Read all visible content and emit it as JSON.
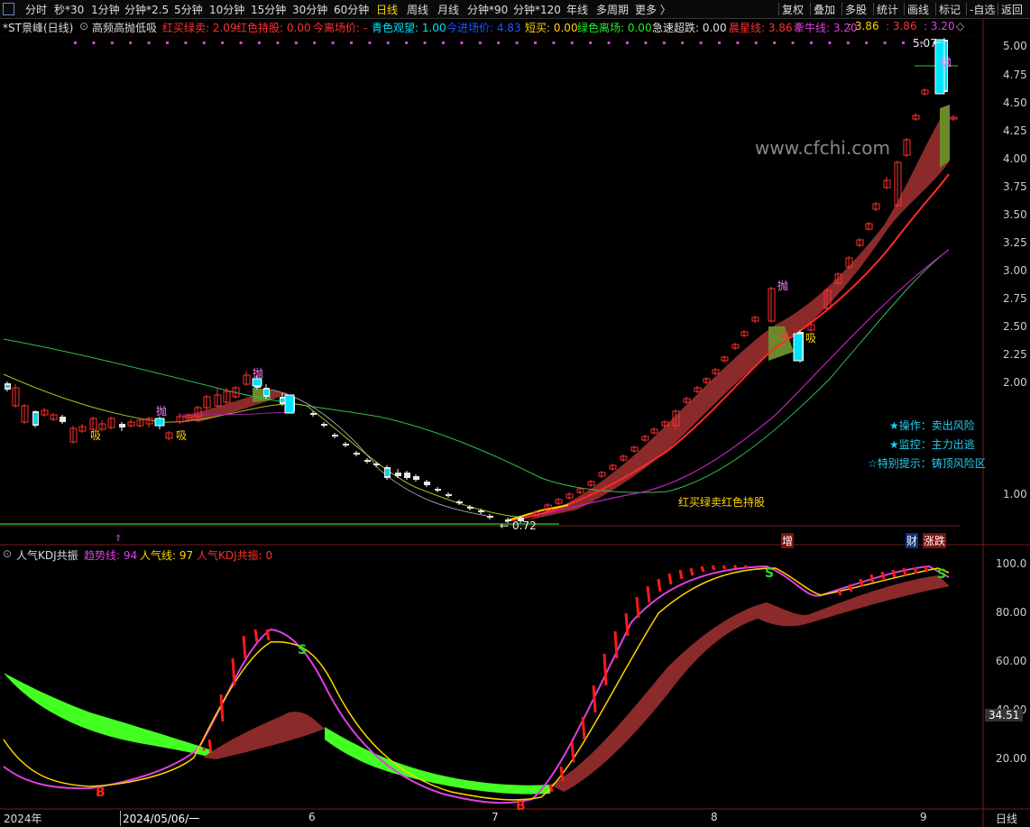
{
  "toolbar": {
    "left": [
      "分时",
      "秒*30",
      "1分钟",
      "分钟*2.5",
      "5分钟",
      "10分钟",
      "15分钟",
      "30分钟",
      "60分钟",
      "日线",
      "周线",
      "月线",
      "分钟*90",
      "分钟*120",
      "年线",
      "多周期",
      "更多 〉"
    ],
    "selected": "日线",
    "right": [
      "复权",
      "叠加",
      "多股",
      "统计",
      "画线",
      "标记",
      "-自选",
      "返回"
    ]
  },
  "main_info": {
    "title": "*ST景峰(日线)",
    "indicator": "高频高抛低吸",
    "items": [
      {
        "text": "红买绿卖: 2.09",
        "color": "#ff3030"
      },
      {
        "text": "红色持股: 0.00",
        "color": "#ff3030"
      },
      {
        "text": "今离场价: -",
        "color": "#ff3030"
      },
      {
        "text": "青色观望: 1.00",
        "color": "#00e5ff"
      },
      {
        "text": "今进场价: 4.83",
        "color": "#2255ff"
      },
      {
        "text": "短买: 0.00",
        "color": "#ffd400"
      },
      {
        "text": "绿色离场: 0.00",
        "color": "#22ee22"
      },
      {
        "text": "急速超跌: 0.00",
        "color": "#e0e0e0"
      },
      {
        "text": "晨星线: 3.86",
        "color": "#ff3030"
      },
      {
        "text": "牽牛线: 3.20",
        "color": "#e040e0"
      },
      {
        "text": ": 3.86",
        "color": "#ffd400"
      },
      {
        "text": ": 3.86",
        "color": "#ff3030"
      },
      {
        "text": ": 3.20",
        "color": "#e040e0"
      }
    ]
  },
  "price_axis": [
    "5.00",
    "4.75",
    "4.50",
    "4.25",
    "4.00",
    "3.75",
    "3.50",
    "3.25",
    "3.00",
    "2.75",
    "2.50",
    "2.25",
    "2.00",
    "1.00"
  ],
  "price_axis_full": [
    5.0,
    4.75,
    4.5,
    4.25,
    4.0,
    3.75,
    3.5,
    3.25,
    3.0,
    2.75,
    2.5,
    2.25,
    2.0,
    1.0
  ],
  "watermark": "www.cfchi.com",
  "annotations": {
    "high_label": "5.07",
    "low_label": "0.72",
    "pao": "抛",
    "xi": "吸",
    "hongmai": "红买绿卖红色持股",
    "op1": "★操作：卖出风险",
    "op2": "★监控：主力出逃",
    "op3": "☆特别提示：铸顶风险区",
    "zeng": "增",
    "cai": "财",
    "zhangdie": "涨跌"
  },
  "kdj_info": {
    "name": "人气KDJ共振",
    "items": [
      {
        "text": "趋势线: 94",
        "color": "#e040e0"
      },
      {
        "text": "人气线: 97",
        "color": "#ffd400"
      },
      {
        "text": "人气KDJ共振: 0",
        "color": "#ff3030"
      }
    ]
  },
  "kdj_axis": [
    "100.0",
    "80.00",
    "60.00",
    "40.00",
    "20.00"
  ],
  "kdj_current": "34.51",
  "kdj_marks": {
    "b": "B",
    "s": "S"
  },
  "x_axis": {
    "year": "2024年",
    "date": "2024/05/06/一",
    "months": [
      "6",
      "7",
      "8",
      "9"
    ],
    "period": "日线"
  },
  "chart_data": {
    "type": "candlestick",
    "y_range": [
      0.72,
      5.07
    ],
    "kdj": {
      "trend": 94,
      "popularity": 97,
      "resonance": 0,
      "ylim": [
        0,
        100
      ]
    }
  }
}
